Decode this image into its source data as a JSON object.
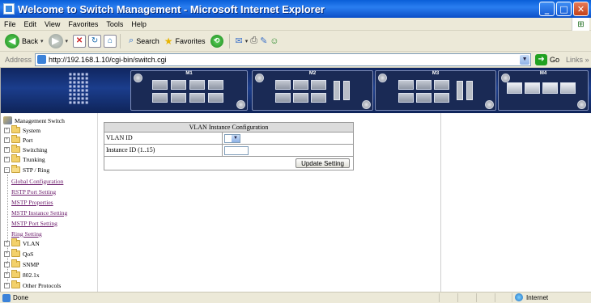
{
  "window": {
    "title": "Welcome to Switch Management - Microsoft Internet Explorer"
  },
  "menu": [
    "File",
    "Edit",
    "View",
    "Favorites",
    "Tools",
    "Help"
  ],
  "toolbar": {
    "back": "Back",
    "search": "Search",
    "favorites": "Favorites"
  },
  "address": {
    "label": "Address",
    "url": "http://192.168.1.10/cgi-bin/switch.cgi",
    "go": "Go",
    "links": "Links"
  },
  "banner": {
    "modules": [
      {
        "name": "M1",
        "top_numbers": [
          "1",
          "3",
          "5",
          "7"
        ],
        "bottom_numbers": [
          "2",
          "4",
          "6",
          "8"
        ]
      },
      {
        "name": "M2",
        "top_numbers": [
          "1",
          "3",
          "5"
        ],
        "bottom_numbers": [
          "2",
          "4",
          "6",
          "7",
          "8"
        ]
      },
      {
        "name": "M3",
        "top_numbers": [
          "1",
          "3",
          "5"
        ],
        "bottom_numbers": [
          "2",
          "4",
          "6",
          "7",
          "8"
        ]
      },
      {
        "name": "M4",
        "bottom_numbers": [
          "G1",
          "G2",
          "G3",
          "G4"
        ]
      }
    ]
  },
  "sidebar": {
    "root": "Management Switch",
    "items": [
      {
        "label": "System",
        "type": "folder"
      },
      {
        "label": "Port",
        "type": "folder"
      },
      {
        "label": "Switching",
        "type": "folder"
      },
      {
        "label": "Trunking",
        "type": "folder"
      },
      {
        "label": "STP / Ring",
        "type": "folder-open"
      },
      {
        "label": "Global Configuration",
        "type": "leaf"
      },
      {
        "label": "RSTP Port Setting",
        "type": "leaf"
      },
      {
        "label": "MSTP Properties",
        "type": "leaf"
      },
      {
        "label": "MSTP Instance Setting",
        "type": "leaf"
      },
      {
        "label": "MSTP Port Setting",
        "type": "leaf"
      },
      {
        "label": "Ring Setting",
        "type": "leaf"
      },
      {
        "label": "VLAN",
        "type": "folder"
      },
      {
        "label": "QoS",
        "type": "folder"
      },
      {
        "label": "SNMP",
        "type": "folder"
      },
      {
        "label": "802.1x",
        "type": "folder"
      },
      {
        "label": "Other Protocols",
        "type": "folder"
      }
    ]
  },
  "form": {
    "header": "VLAN Instance Configuration",
    "vlan_id_label": "VLAN ID",
    "vlan_id_value": "",
    "instance_id_label": "Instance ID (1..15)",
    "instance_id_value": "",
    "update_button": "Update Setting"
  },
  "status": {
    "text": "Done",
    "zone": "Internet"
  }
}
